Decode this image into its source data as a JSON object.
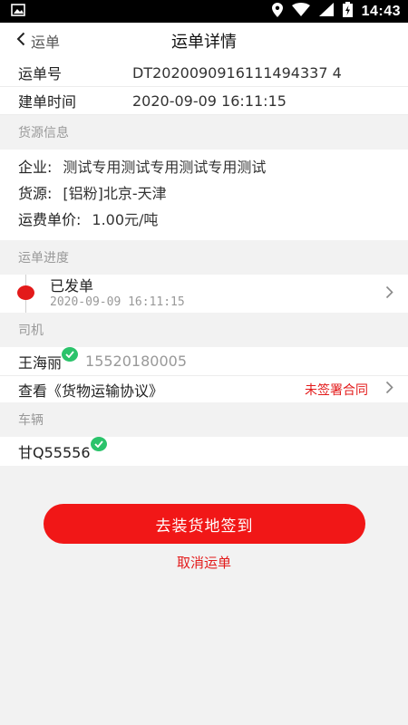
{
  "status_bar": {
    "time": "14:43",
    "icons": [
      "image-notification-icon",
      "location-icon",
      "wifi-icon",
      "signal-icon",
      "battery-charging-icon"
    ]
  },
  "nav": {
    "back_label": "运单",
    "title": "运单详情"
  },
  "waybill": {
    "number_label": "运单号",
    "number_value": "DT2020090916111494337 4",
    "created_label": "建单时间",
    "created_value": "2020-09-09 16:11:15"
  },
  "cargo": {
    "section_title": "货源信息",
    "company_label": "企业:",
    "company_value": "测试专用测试专用测试专用测试",
    "source_label": "货源:",
    "source_value": "[铝粉]北京-天津",
    "price_label": "运费单价:",
    "price_value": "1.00元/吨"
  },
  "progress": {
    "section_title": "运单进度",
    "status": "已发单",
    "time": "2020-09-09 16:11:15"
  },
  "driver": {
    "section_title": "司机",
    "name": "王海丽",
    "phone": "15520180005",
    "agreement_label": "查看《货物运输协议》",
    "agreement_status": "未签署合同"
  },
  "vehicle": {
    "section_title": "车辆",
    "plate": "甘Q55556"
  },
  "actions": {
    "primary": "去装货地签到",
    "cancel": "取消运单"
  },
  "colors": {
    "accent_red": "#f11717",
    "verified_green": "#2bc36b"
  }
}
